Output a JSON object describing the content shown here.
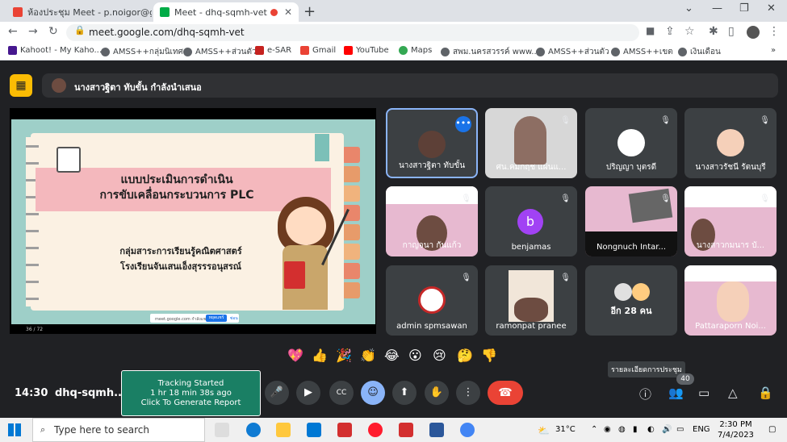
{
  "browser": {
    "tabs": [
      {
        "title": "ห้องประชุม Meet - p.noigor@gmail...",
        "color": "#ea4335"
      },
      {
        "title": "Meet - dhq-sqmh-vet",
        "color": "#00ac47"
      }
    ],
    "new_tab": "+",
    "url": "meet.google.com/dhq-sqmh-vet",
    "bookmarks": [
      "Kahoot! - My Kaho...",
      "AMSS++กลุ่มนิเทศ",
      "AMSS++ส่วนตัว",
      "e-SAR",
      "Gmail",
      "YouTube",
      "Maps",
      "สพม.นครสวรรค์ www....",
      "AMSS++ส่วนตัว",
      "AMSS++เขต",
      "เงินเดือน"
    ]
  },
  "meet": {
    "presenter_text": "นางสาวฐิตา ทับขั้น กำลังนำเสนอ",
    "slide": {
      "title_line1": "แบบประเมินการดำเนิน",
      "title_line2": "การขับเคลื่อนกระบวนการ PLC",
      "sub_line1": "กลุ่มสาระการเรียนรู้คณิตศาสตร์",
      "sub_line2": "โรงเรียนจันเสนเอ็งสุรรรอนุสรณ์",
      "share_text": "meet.google.com กำลังแชร์หน้าต่าง",
      "stop_label": "หยุดแชร์",
      "hide_label": "ซ่อน",
      "page": "36 / 72"
    },
    "tiles": [
      {
        "name": "นางสาวฐิตา ทับขั้น"
      },
      {
        "name": "ศน.คมกฤช แผ่นแ..."
      },
      {
        "name": "ปริญญา บุตรดี"
      },
      {
        "name": "นางสาวรัชนี รัตนบุรี"
      },
      {
        "name": "กาญจนา กันแก้ว"
      },
      {
        "name": "benjamas",
        "initial": "b"
      },
      {
        "name": "Nongnuch Intar..."
      },
      {
        "name": "นางสาวกมนาร บั..."
      },
      {
        "name": "admin spmsawan"
      },
      {
        "name": "ramonpat pranee"
      },
      {
        "name": "อีก 28 คน"
      },
      {
        "name": "Pattaraporn Noi..."
      }
    ],
    "time": "14:30",
    "meeting_code": "dhq-sqmh...",
    "tracking": {
      "line1": "Tracking Started",
      "line2": "1 hr 18 min 38s ago",
      "line3": "Click To Generate Report"
    },
    "tooltip": "รายละเอียดการประชุม",
    "participants_count": "40",
    "reactions": [
      "💖",
      "👍",
      "🎉",
      "👏",
      "😂",
      "😮",
      "😢",
      "🤔",
      "👎"
    ]
  },
  "taskbar": {
    "search_placeholder": "Type here to search",
    "weather": "31°C",
    "lang": "ENG",
    "time": "2:30 PM",
    "date": "7/4/2023"
  }
}
